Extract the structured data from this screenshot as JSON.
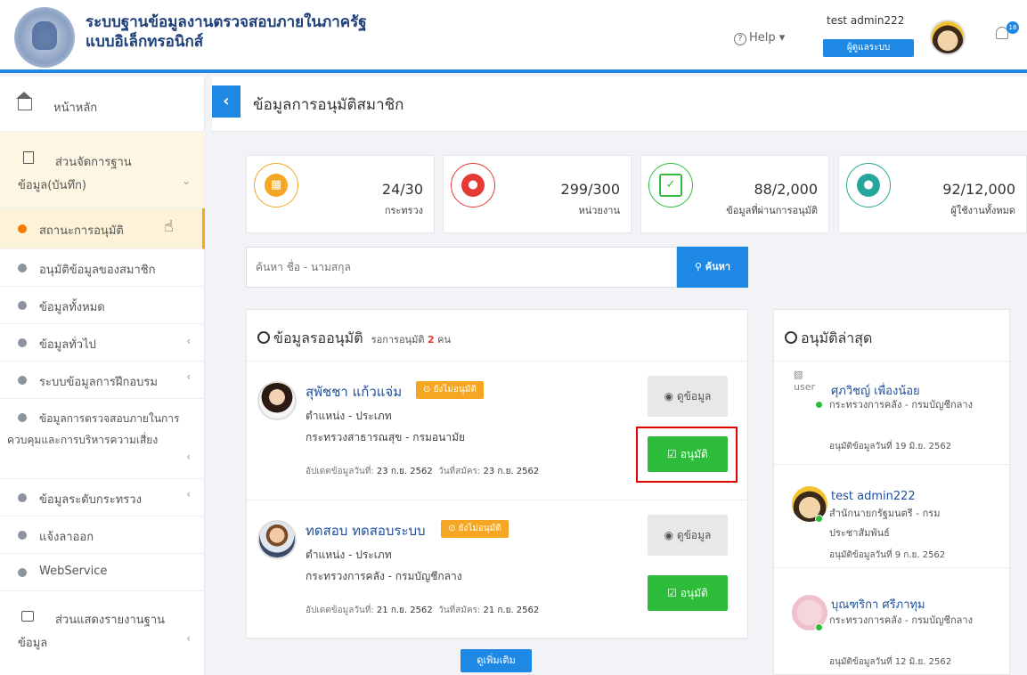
{
  "header": {
    "title_line1": "ระบบฐานข้อมูลงานตรวจสอบภายในภาครัฐ",
    "title_line2": "แบบอิเล็กทรอนิกส์",
    "help_label": "Help ▾",
    "user_name": "test admin222",
    "role_label": "ผู้ดูแลระบบ",
    "notification_count": "18"
  },
  "sidebar": {
    "home": "หน้าหลัก",
    "group1": "ส่วนจัดการฐานข้อมูล(บันทึก)",
    "items": [
      "สถานะการอนุมัติ",
      "อนุมัติข้อมูลของสมาชิก",
      "ข้อมูลทั้งหมด",
      "ข้อมูลทั่วไป",
      "ระบบข้อมูลการฝึกอบรม",
      "ข้อมูลการตรวจสอบภายในการควบคุมและการบริหารความเสี่ยง",
      "ข้อมูลระดับกระทรวง",
      "แจ้งลาออก",
      "WebService"
    ],
    "group2": "ส่วนแสดงรายงานฐานข้อมูล"
  },
  "page": {
    "title": "ข้อมูลการอนุมัติสมาชิก"
  },
  "stats": [
    {
      "value": "24/30",
      "label": "กระทรวง",
      "color": "#f5a623"
    },
    {
      "value": "299/300",
      "label": "หน่วยงาน",
      "color": "#e53935"
    },
    {
      "value": "88/2,000",
      "label": "ข้อมูลที่ผ่านการอนุมัติ",
      "color": "#2ebd3a"
    },
    {
      "value": "92/12,000",
      "label": "ผู้ใช้งานทั้งหมด",
      "color": "#26a69a"
    }
  ],
  "search": {
    "placeholder": "ค้นหา ชื่อ - นามสกุล",
    "button": "ค้นหา"
  },
  "pending": {
    "title": "ข้อมูลรออนุมัติ",
    "sub_prefix": "รอการอนุมัติ",
    "count": "2",
    "sub_suffix": "คน",
    "rows": [
      {
        "name": "สุพัชชา แก้วแจ่ม",
        "status": "ยังไม่อนุมัติ",
        "position": "ตำแหน่ง - ประเภท",
        "org": "กระทรวงสาธารณสุข - กรมอนามัย",
        "updated_label": "อัปเดตข้อมูลวันที่:",
        "updated": "23 ก.ย. 2562",
        "applied_label": "วันที่สมัคร:",
        "applied": "23 ก.ย. 2562",
        "view": "ดูข้อมูล",
        "approve": "อนุมัติ"
      },
      {
        "name": "ทดสอบ ทดสอบระบบ",
        "status": "ยังไม่อนุมัติ",
        "position": "ตำแหน่ง - ประเภท",
        "org": "กระทรวงการคลัง - กรมบัญชีกลาง",
        "updated_label": "อัปเดตข้อมูลวันที่:",
        "updated": "21 ก.ย. 2562",
        "applied_label": "วันที่สมัคร:",
        "applied": "21 ก.ย. 2562",
        "view": "ดูข้อมูล",
        "approve": "อนุมัติ"
      }
    ],
    "more": "ดูเพิ่มเติม"
  },
  "latest": {
    "title": "อนุมัติล่าสุด",
    "items": [
      {
        "name": "ศุภวิชญ์ เพื่องน้อย",
        "org": "กระทรวงการคลัง - กรมบัญชีกลาง",
        "date": "อนุมัติข้อมูลวันที่ 19 มิ.ย. 2562",
        "alt": "user"
      },
      {
        "name": "test admin222",
        "org": "สำนักนายกรัฐมนตรี - กรมประชาสัมพันธ์",
        "date": "อนุมัติข้อมูลวันที่ 9 ก.ย. 2562"
      },
      {
        "name": "บุณฑริกา ศรีภาทุม",
        "org": "กระทรวงการคลัง - กรมบัญชีกลาง",
        "date": "อนุมัติข้อมูลวันที่ 12 มิ.ย. 2562"
      }
    ]
  }
}
